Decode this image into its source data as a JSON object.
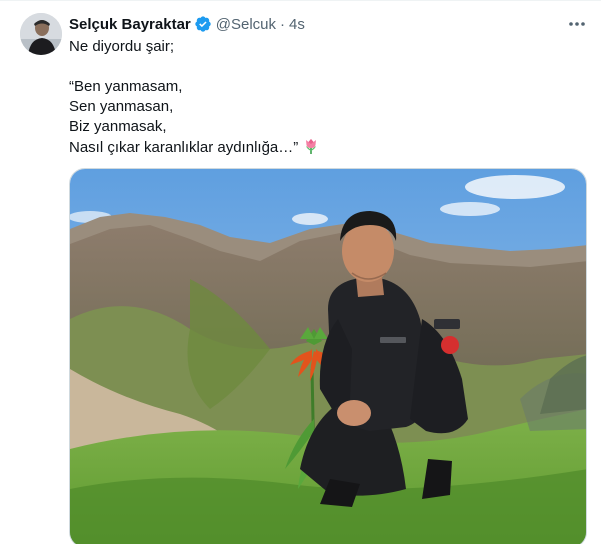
{
  "author": {
    "name": "Selçuk Bayraktar",
    "handle": "@Selcuk",
    "separator": "·",
    "time": "4s",
    "verified": true,
    "avatar_icon": "person-avatar",
    "verified_color": "#1d9bf0"
  },
  "tweet": {
    "intro": "Ne diyordu şair;",
    "poem": [
      "“Ben yanmasam,",
      "Sen yanmasan,",
      "Biz yanmasak,",
      "Nasıl çıkar karanlıklar aydınlığa…”"
    ],
    "emoji": "tulip"
  },
  "media": {
    "type": "photo",
    "description_icon": "mountain-landscape-photo"
  },
  "menu": {
    "icon": "more-horizontal-icon"
  },
  "colors": {
    "text": "#0f1419",
    "secondary": "#536471",
    "border": "#cfd9de"
  }
}
